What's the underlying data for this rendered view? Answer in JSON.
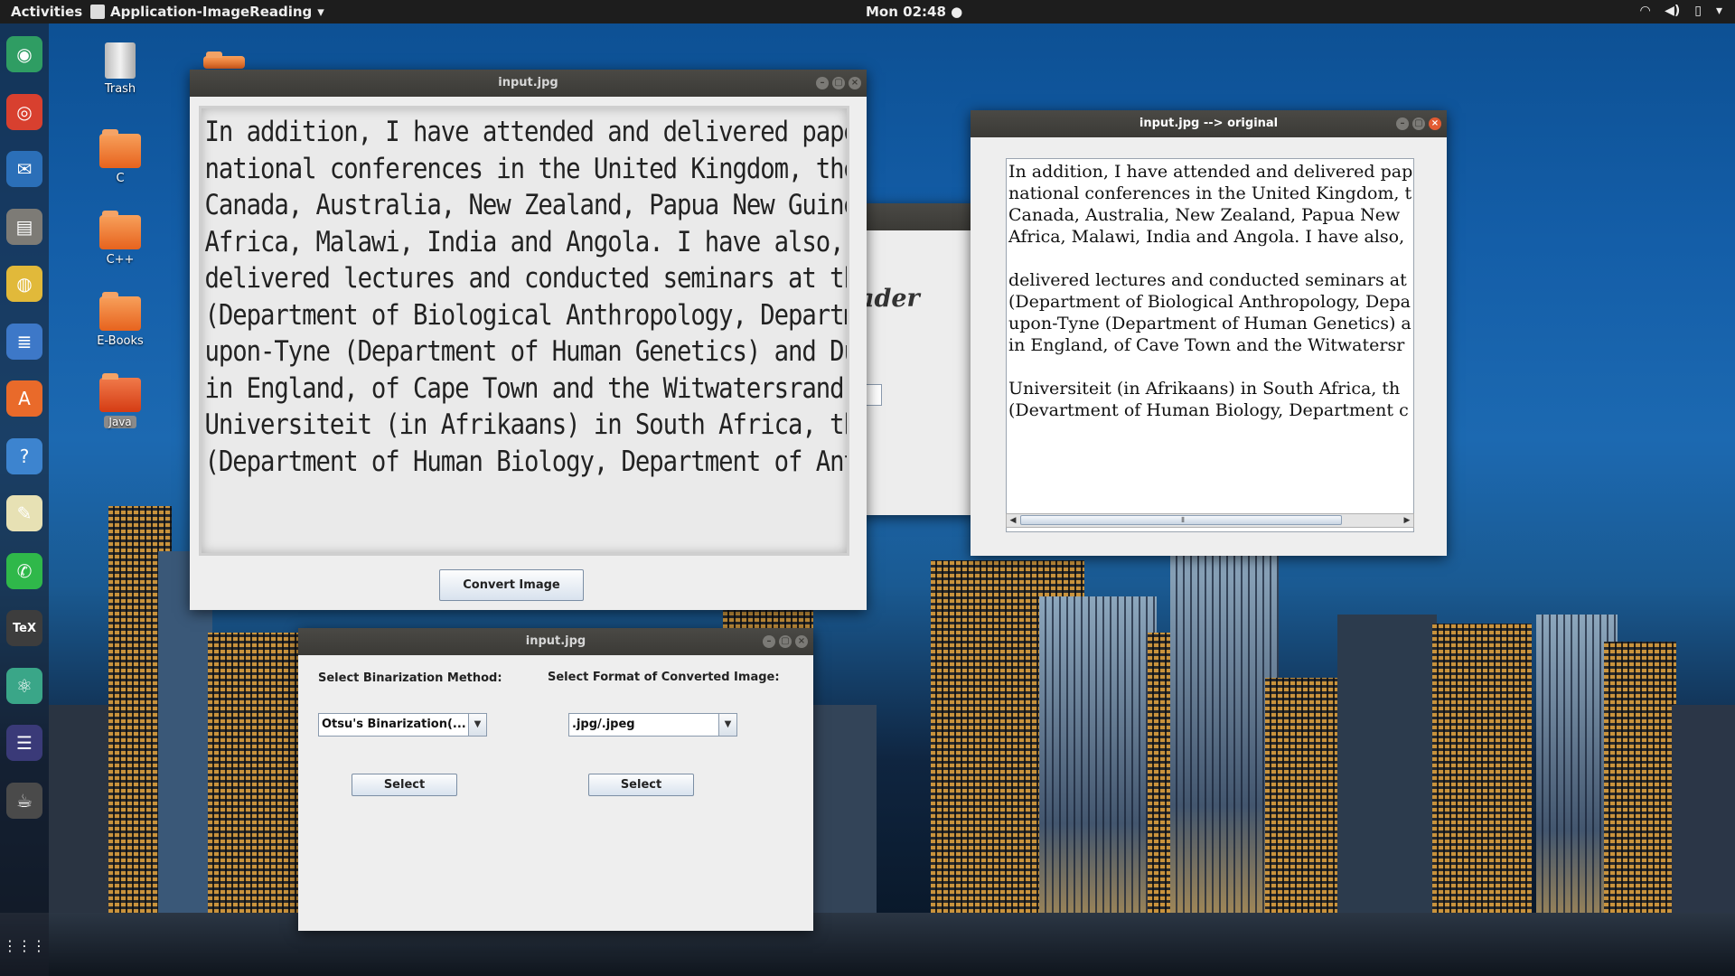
{
  "topbar": {
    "activities": "Activities",
    "app_name": "Application-ImageReading",
    "app_menu_arrow": "▾",
    "clock": "Mon 02:48 ●",
    "tray": {
      "wifi_icon": "wifi-icon",
      "volume_icon": "volume-icon",
      "battery_icon": "battery-icon",
      "menu_arrow": "▾"
    }
  },
  "dock": {
    "items": [
      {
        "name": "android-studio-icon",
        "glyph": "◉",
        "color": "#2f9d63"
      },
      {
        "name": "chrome-icon",
        "glyph": "◎",
        "color": "#d8402f"
      },
      {
        "name": "thunderbird-icon",
        "glyph": "✉",
        "color": "#2b6fb8"
      },
      {
        "name": "files-icon",
        "glyph": "▤",
        "color": "#7d7b76"
      },
      {
        "name": "rhythmbox-icon",
        "glyph": "◍",
        "color": "#e1b93a"
      },
      {
        "name": "libreoffice-writer-icon",
        "glyph": "≣",
        "color": "#3d78c8"
      },
      {
        "name": "software-center-icon",
        "glyph": "A",
        "color": "#e96a2a"
      },
      {
        "name": "help-icon",
        "glyph": "?",
        "color": "#3d84cf"
      },
      {
        "name": "text-editor-icon",
        "glyph": "✎",
        "color": "#e7e1b4"
      },
      {
        "name": "whatsapp-icon",
        "glyph": "✆",
        "color": "#2fb84a"
      },
      {
        "name": "texmaker-icon",
        "glyph": "TeX",
        "color": "#3d3d3d"
      },
      {
        "name": "atom-icon",
        "glyph": "⚛",
        "color": "#3aa688"
      },
      {
        "name": "eclipse-icon",
        "glyph": "☰",
        "color": "#3a3a78"
      },
      {
        "name": "java-app-icon",
        "glyph": "☕",
        "color": "#4a4a4a"
      }
    ],
    "grid_glyph": "⋮⋮⋮"
  },
  "desktop": {
    "icons": [
      {
        "label": "Trash"
      },
      {
        "label": "C"
      },
      {
        "label": "C++"
      },
      {
        "label": "E-Books"
      },
      {
        "label": "Java"
      }
    ]
  },
  "win_image": {
    "title": "input.jpg",
    "scan_lines": [
      "In addition, I have attended and delivered paper",
      "national conferences in the United Kingdom, the U",
      "Canada, Australia, New Zealand, Papua New Guinea",
      "Africa, Malawi, India and Angola. I have also, a",
      "delivered lectures and conducted seminars at the",
      "(Department of Biological Anthropology, Departme",
      "upon-Tyne (Department of Human Genetics) and Durh",
      "in England, of Cape Town and the Witwatersrand a",
      "Universiteit (in Afrikaans) in South Africa, the",
      "(Department of Human Biology, Department of Anth"
    ],
    "convert_button": "Convert Image"
  },
  "win_behind": {
    "partial_text": "ader"
  },
  "win_text": {
    "title": "input.jpg --> original",
    "lines": [
      "In addition, I have attended and delivered pap",
      "national conferences in the United Kingdom, t",
      "Canada, Australia, New Zealand, Papua New",
      "Africa, Malawi, India and Angola. I have also,",
      "",
      "delivered lectures and conducted seminars at",
      "(Department of Biological Anthropology, Depa",
      "upon-Tyne (Department of Human Genetics) a",
      "in England, of Cave Town and the Witwatersr",
      "",
      "Universiteit (in Afrikaans) in South Africa, th",
      "(Devartment of Human Biology, Department c"
    ],
    "scroll_left": "◀",
    "scroll_right": "▶",
    "scroll_grip": "⦀"
  },
  "win_options": {
    "title": "input.jpg",
    "binarization_label": "Select Binarization Method:",
    "binarization_value": "Otsu's Binarization(...",
    "format_label": "Select Format of Converted Image:",
    "format_value": ".jpg/.jpeg",
    "select_button_left": "Select",
    "select_button_right": "Select",
    "combo_arrow": "▼"
  },
  "window_buttons": {
    "minimize": "–",
    "maximize": "▢",
    "close": "×"
  }
}
